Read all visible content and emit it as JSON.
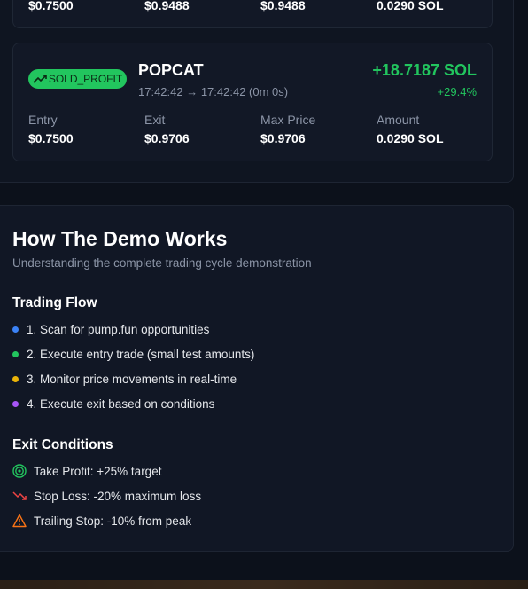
{
  "prev_trade": {
    "entry": "$0.7500",
    "exit": "$0.9488",
    "max_price": "$0.9488",
    "amount": "0.0290 SOL"
  },
  "trade": {
    "badge": "SOLD_PROFIT",
    "token": "POPCAT",
    "time": "17:42:42 → 17:42:42 (0m 0s)",
    "pnl": "+18.7187 SOL",
    "pct": "+29.4%",
    "labels": {
      "entry": "Entry",
      "exit": "Exit",
      "max_price": "Max Price",
      "amount": "Amount"
    },
    "entry": "$0.7500",
    "exit": "$0.9706",
    "max_price": "$0.9706",
    "amount": "0.0290 SOL"
  },
  "demo": {
    "title": "How The Demo Works",
    "subtitle": "Understanding the complete trading cycle demonstration",
    "flow_title": "Trading Flow",
    "flow": [
      {
        "text": "1. Scan for pump.fun opportunities",
        "color": "#3b82f6"
      },
      {
        "text": "2. Execute entry trade (small test amounts)",
        "color": "#22c55e"
      },
      {
        "text": "3. Monitor price movements in real-time",
        "color": "#eab308"
      },
      {
        "text": "4. Execute exit based on conditions",
        "color": "#a855f7"
      }
    ],
    "exit_title": "Exit Conditions",
    "exits": [
      {
        "text": "Take Profit: +25% target",
        "icon": "target-icon"
      },
      {
        "text": "Stop Loss: -20% maximum loss",
        "icon": "trending-down-icon"
      },
      {
        "text": "Trailing Stop: -10% from peak",
        "icon": "warning-icon"
      }
    ]
  },
  "colors": {
    "accent_green": "#22c55e",
    "stop_red": "#ef4444",
    "warning_orange": "#f97316"
  }
}
